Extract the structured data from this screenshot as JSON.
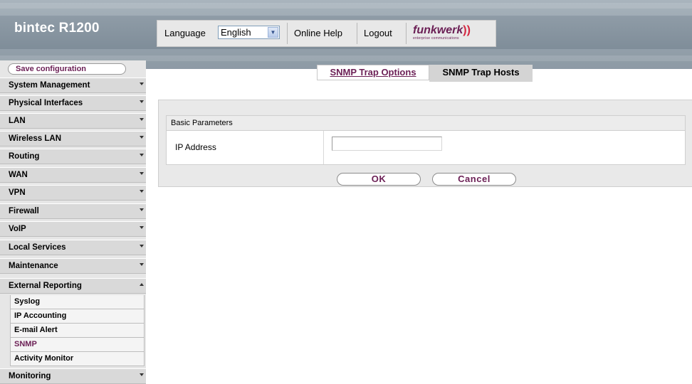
{
  "brand": {
    "title": "bintec R1200"
  },
  "topbar": {
    "language_label": "Language",
    "language_value": "English",
    "online_help": "Online Help",
    "logout": "Logout",
    "logo_word": "funkwerk",
    "logo_waves": "))",
    "logo_sub": "enterprise communications"
  },
  "sidebar": {
    "save_label": "Save configuration",
    "items": [
      {
        "label": "System Management"
      },
      {
        "label": "Physical Interfaces"
      },
      {
        "label": "LAN"
      },
      {
        "label": "Wireless LAN"
      },
      {
        "label": "Routing"
      },
      {
        "label": "WAN"
      },
      {
        "label": "VPN"
      },
      {
        "label": "Firewall"
      },
      {
        "label": "VoIP"
      },
      {
        "label": "Local Services"
      },
      {
        "label": "Maintenance"
      },
      {
        "label": "External Reporting"
      },
      {
        "label": "Monitoring"
      }
    ],
    "submenu": [
      {
        "label": "Syslog"
      },
      {
        "label": "IP Accounting"
      },
      {
        "label": "E-mail Alert"
      },
      {
        "label": "SNMP"
      },
      {
        "label": "Activity Monitor"
      }
    ]
  },
  "tabs": {
    "options": "SNMP Trap Options",
    "hosts": "SNMP Trap Hosts"
  },
  "form": {
    "section_title": "Basic Parameters",
    "ip_label": "IP Address",
    "ip_value": "",
    "ok_label": "OK",
    "cancel_label": "Cancel"
  },
  "colors": {
    "accent": "#6b1f55",
    "menu_bg": "#d9d9d9",
    "header_bg": "#96a3ad"
  }
}
